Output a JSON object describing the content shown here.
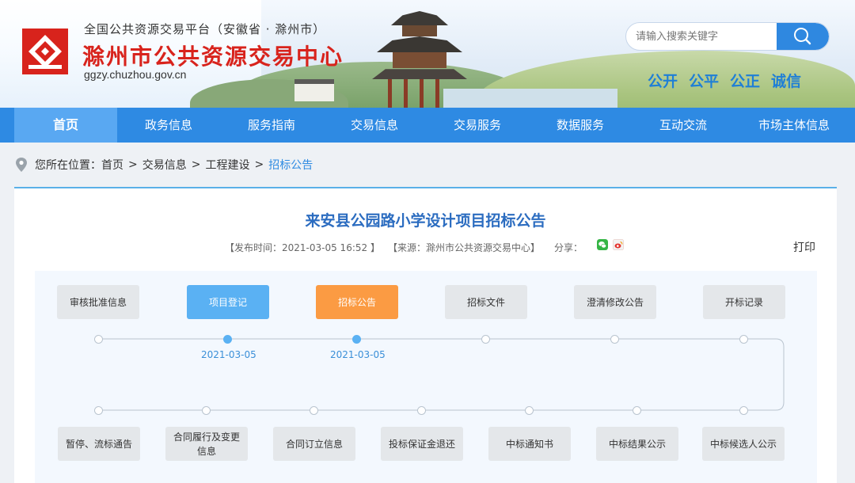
{
  "header": {
    "sub_title": "全国公共资源交易平台（安徽省 · 滁州市）",
    "main_title": "滁州市公共资源交易中心",
    "domain": "ggzy.chuzhou.gov.cn",
    "search_placeholder": "请输入搜索关键字",
    "slogans": [
      "公开",
      "公平",
      "公正",
      "诚信"
    ],
    "brand_color": "#d8231c",
    "accent_color": "#2e8ae3",
    "logo_icon": "house-diamond-logo",
    "search_icon": "magnifier-icon"
  },
  "nav": {
    "items": [
      "首页",
      "政务信息",
      "服务指南",
      "交易信息",
      "交易服务",
      "数据服务",
      "互动交流",
      "市场主体信息"
    ],
    "active": "首页"
  },
  "breadcrumb": {
    "prefix": "您所在位置：",
    "items": [
      "首页",
      "交易信息",
      "工程建设",
      "招标公告"
    ],
    "separator": ">",
    "icon": "location-pin-icon"
  },
  "article": {
    "title": "来安县公园路小学设计项目招标公告",
    "publish": "【发布时间：2021-03-05 16:52 】",
    "source": "【来源：滁州市公共资源交易中心】",
    "share_label": "分享：",
    "share_icons": [
      "wechat-icon",
      "weibo-icon"
    ],
    "print_label": "打印"
  },
  "flow": {
    "top_steps": [
      {
        "label": "审核批准信息",
        "state": "none",
        "date": ""
      },
      {
        "label": "项目登记",
        "state": "done",
        "date": "2021-03-05"
      },
      {
        "label": "招标公告",
        "state": "current",
        "date": "2021-03-05"
      },
      {
        "label": "招标文件",
        "state": "none",
        "date": ""
      },
      {
        "label": "澄清修改公告",
        "state": "none",
        "date": ""
      },
      {
        "label": "开标记录",
        "state": "none",
        "date": ""
      }
    ],
    "bottom_steps": [
      {
        "label": "暂停、流标通告"
      },
      {
        "label": "合同履行及变更信息"
      },
      {
        "label": "合同订立信息"
      },
      {
        "label": "投标保证金退还"
      },
      {
        "label": "中标通知书"
      },
      {
        "label": "中标结果公示"
      },
      {
        "label": "中标候选人公示"
      }
    ],
    "colors": {
      "done": "#5ab1f3",
      "current": "#fb9b43",
      "idle": "#e4e7ea"
    }
  }
}
